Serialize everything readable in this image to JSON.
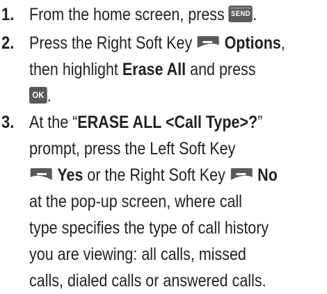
{
  "steps": [
    {
      "number": "1.",
      "line1_text": "From the home screen, press",
      "line1_after": ".",
      "key": "SEND"
    },
    {
      "number": "2.",
      "line1_text": "Press the Right Soft Key",
      "line1_bold": "Options",
      "line1_after": ",",
      "line2_pre": "then highlight",
      "line2_bold": "Erase All",
      "line2_post": "and press",
      "key": "OK",
      "line3_after": "."
    },
    {
      "number": "3.",
      "line1_pre": "At the “",
      "line1_bold": "ERASE ALL <Call Type>?",
      "line1_post": "”",
      "line2": "prompt, press the Left Soft Key",
      "line3_bold_yes": "Yes",
      "line3_mid": "or the Right Soft Key",
      "line3_bold_no": "No",
      "line4": "at the  pop-up screen, where call",
      "line5": "type specifies the type of call history",
      "line6": "you are viewing: all calls, missed",
      "line7": "calls, dialed calls or answered calls."
    }
  ],
  "colors": {
    "text": "#231f20",
    "key_fill": "#58595b",
    "key_text": "#ffffff"
  },
  "icons": {
    "send": "send-key-icon",
    "ok": "ok-key-icon",
    "soft_key": "soft-key-icon"
  }
}
